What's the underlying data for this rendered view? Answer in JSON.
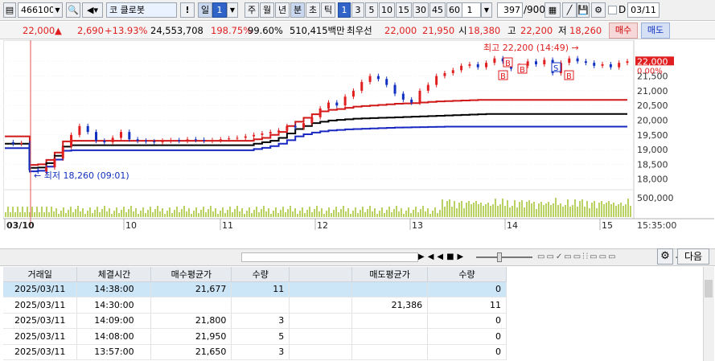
{
  "toolbar": {
    "code": "466100",
    "market_prefix": "코",
    "stock_name": "클로봇",
    "warning": "!",
    "period_day": "일",
    "period_day_count": "1",
    "periods": [
      "주",
      "월",
      "년",
      "분",
      "초",
      "틱"
    ],
    "selected_period": "분",
    "intervals": [
      "1",
      "3",
      "5",
      "10",
      "15",
      "30",
      "45",
      "60"
    ],
    "selected_interval": "1",
    "interval_custom": "1",
    "data_count": "397",
    "data_max": "/900",
    "date_checkbox_label": "D",
    "date_value": "03/11"
  },
  "quote": {
    "price": "22,000",
    "arrow": "▲",
    "change": "2,690",
    "change_pct": "+13.93%",
    "volume": "24,553,708",
    "volume_ratio": "198.75%",
    "turnover_ratio": "99.60%",
    "amount": "510,415백만",
    "best_label": "최우선",
    "best_ask": "22,000",
    "best_bid": "21,950",
    "open_label": "시",
    "open": "18,380",
    "high_label": "고",
    "high": "22,200",
    "low_label": "저",
    "low": "18,260",
    "buy_button": "매수",
    "sell_button": "매도"
  },
  "colors": {
    "up": "#e02020",
    "down": "#1030c0",
    "volume": "#b9d160",
    "envelope_mid": "#000000"
  },
  "chart": {
    "price_axis": [
      "22,000",
      "21,500",
      "21,000",
      "20,500",
      "20,000",
      "19,500",
      "19,000",
      "18,500",
      "18,000"
    ],
    "current_price_tag": "22,000",
    "current_pct_tag": "0.00%",
    "volume_axis": "500,000",
    "date_labels": [
      "03/10",
      "10",
      "11",
      "12",
      "13",
      "14",
      "15"
    ],
    "time_label": "15:35:00",
    "high_annotation": "최고 22,200 (14:49)",
    "low_annotation": "최저 18,260 (09:01)",
    "signal_markers": [
      "B",
      "B",
      "B",
      "S",
      "B"
    ]
  },
  "chart_data": {
    "type": "line",
    "title": "",
    "ylim": [
      17800,
      22500
    ],
    "price": [
      19250,
      19200,
      19220,
      18300,
      18260,
      18400,
      18700,
      19100,
      19500,
      19800,
      19600,
      19300,
      19250,
      19400,
      19600,
      19350,
      19300,
      19280,
      19250,
      19300,
      19320,
      19300,
      19350,
      19330,
      19300,
      19320,
      19350,
      19380,
      19400,
      19450,
      19500,
      19550,
      19600,
      19650,
      19800,
      19750,
      19900,
      20100,
      20400,
      20600,
      20500,
      20800,
      21000,
      21300,
      21500,
      21400,
      21200,
      20900,
      20700,
      20600,
      21000,
      21200,
      21500,
      21600,
      21700,
      21850,
      21900,
      21800,
      21950,
      22100,
      22000,
      21750,
      21850,
      22000,
      21900,
      22050,
      21600,
      21950,
      22100,
      22000,
      21950,
      21850,
      21900,
      21800,
      21950,
      22000
    ],
    "envelope_upper": [
      19450,
      19450,
      19450,
      18480,
      18500,
      18650,
      18900,
      19280,
      19300,
      19300,
      19300,
      19300,
      19300,
      19300,
      19300,
      19300,
      19300,
      19300,
      19300,
      19300,
      19300,
      19300,
      19300,
      19300,
      19300,
      19300,
      19300,
      19300,
      19300,
      19300,
      19350,
      19400,
      19500,
      19600,
      19800,
      19950,
      20080,
      20200,
      20300,
      20350,
      20380,
      20420,
      20460,
      20480,
      20500,
      20520,
      20540,
      20560,
      20570,
      20580,
      20600,
      20620,
      20640,
      20650,
      20660,
      20670,
      20680,
      20690,
      20690,
      20690,
      20690,
      20690,
      20690,
      20690,
      20690,
      20690,
      20690,
      20690,
      20690,
      20690,
      20690,
      20690,
      20690,
      20690,
      20690,
      20690
    ],
    "envelope_mid": [
      19200,
      19200,
      19200,
      18380,
      18390,
      18540,
      18790,
      19100,
      19150,
      19150,
      19150,
      19150,
      19150,
      19150,
      19150,
      19150,
      19150,
      19150,
      19150,
      19150,
      19150,
      19150,
      19150,
      19150,
      19150,
      19150,
      19150,
      19150,
      19150,
      19150,
      19200,
      19250,
      19300,
      19400,
      19550,
      19700,
      19800,
      19900,
      19950,
      19990,
      20010,
      20030,
      20050,
      20060,
      20070,
      20080,
      20090,
      20100,
      20110,
      20120,
      20130,
      20140,
      20150,
      20160,
      20170,
      20180,
      20190,
      20200,
      20210,
      20210,
      20210,
      20210,
      20210,
      20210,
      20210,
      20210,
      20210,
      20210,
      20210,
      20210,
      20210,
      20210,
      20210,
      20210,
      20210,
      20210
    ],
    "envelope_lower": [
      19050,
      19050,
      19050,
      18260,
      18280,
      18420,
      18660,
      18960,
      18980,
      18980,
      18980,
      18980,
      18980,
      18980,
      18980,
      18980,
      18980,
      18980,
      18980,
      18980,
      18980,
      18980,
      18980,
      18980,
      18980,
      18980,
      18980,
      18980,
      18980,
      18980,
      19020,
      19060,
      19120,
      19200,
      19320,
      19450,
      19520,
      19580,
      19620,
      19650,
      19670,
      19690,
      19700,
      19710,
      19720,
      19730,
      19740,
      19750,
      19755,
      19760,
      19765,
      19770,
      19775,
      19780,
      19780,
      19780,
      19780,
      19780,
      19780,
      19780,
      19780,
      19780,
      19780,
      19780,
      19780,
      19780,
      19780,
      19780,
      19780,
      19780,
      19780,
      19780,
      19780,
      19780,
      19780,
      19780
    ]
  },
  "bottom_bar": {
    "settings_icon": "gear-icon",
    "next_button": "다음"
  },
  "table": {
    "headers": [
      "거래일",
      "체결시간",
      "매수평균가",
      "수량",
      "",
      "매도평균가",
      "수량"
    ],
    "rows": [
      [
        "2025/03/11",
        "14:38:00",
        "21,677",
        "11",
        "",
        "",
        "0"
      ],
      [
        "2025/03/11",
        "14:30:00",
        "",
        "",
        "",
        "21,386",
        "11"
      ],
      [
        "2025/03/11",
        "14:09:00",
        "21,800",
        "3",
        "",
        "",
        "0"
      ],
      [
        "2025/03/11",
        "14:08:00",
        "21,950",
        "5",
        "",
        "",
        "0"
      ],
      [
        "2025/03/11",
        "13:57:00",
        "21,650",
        "3",
        "",
        "",
        "0"
      ]
    ]
  }
}
